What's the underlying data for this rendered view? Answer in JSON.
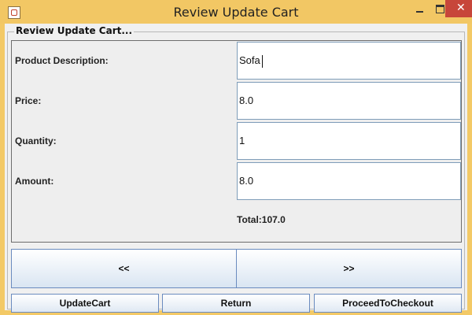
{
  "window": {
    "title": "Review Update Cart"
  },
  "group": {
    "label": "Review Update Cart..."
  },
  "form": {
    "product_label": "Product Description:",
    "product_value": "Sofa",
    "price_label": "Price:",
    "price_value": "8.0",
    "quantity_label": "Quantity:",
    "quantity_value": "1",
    "amount_label": "Amount:",
    "amount_value": "8.0",
    "total": "Total:107.0"
  },
  "navigation": {
    "prev_label": "<<",
    "next_label": ">>"
  },
  "actions": {
    "update_label": "UpdateCart",
    "return_label": "Return",
    "checkout_label": "ProceedToCheckout"
  },
  "icons": {
    "app": "java-app-icon",
    "minimize": "minimize-icon",
    "maximize": "maximize-icon",
    "close": "close-icon"
  },
  "colors": {
    "titlebar": "#f2c764",
    "close_button": "#c7463a",
    "button_border": "#6a8bbf",
    "field_border": "#7f9db9"
  }
}
